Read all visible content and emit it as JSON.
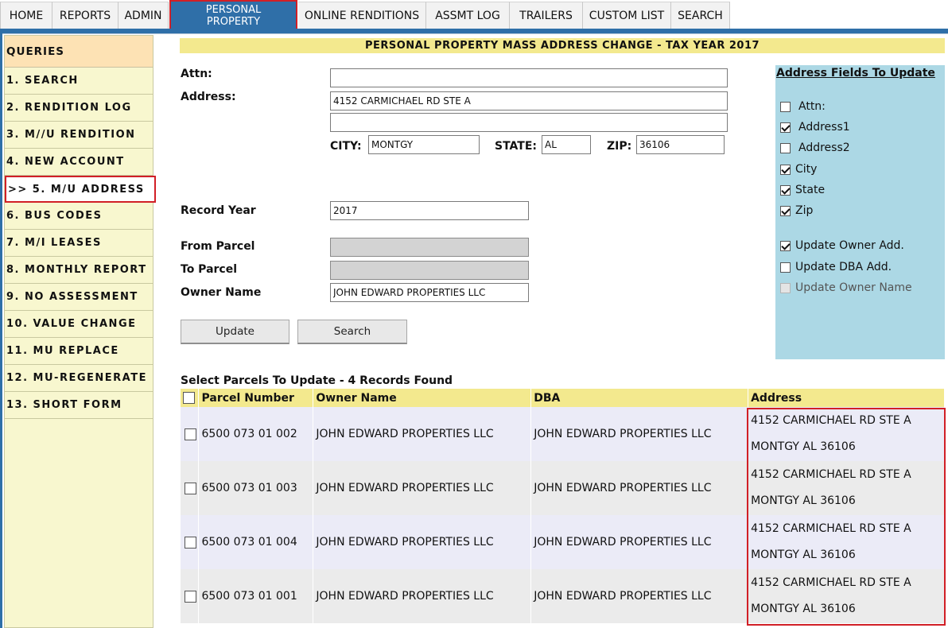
{
  "nav": {
    "tabs": [
      {
        "label": "HOME"
      },
      {
        "label": "REPORTS"
      },
      {
        "label": "ADMIN"
      },
      {
        "label": "PERSONAL PROPERTY",
        "active": true
      },
      {
        "label": "ONLINE RENDITIONS"
      },
      {
        "label": "ASSMT LOG"
      },
      {
        "label": "TRAILERS"
      },
      {
        "label": "CUSTOM LIST"
      },
      {
        "label": "SEARCH"
      }
    ],
    "active_color": "#2f6fa8"
  },
  "sidebar": {
    "header": "QUERIES",
    "items": [
      {
        "label": "1. SEARCH"
      },
      {
        "label": "2. RENDITION LOG"
      },
      {
        "label": "3. M//U RENDITION"
      },
      {
        "label": "4. NEW ACCOUNT"
      },
      {
        "label": ">> 5. M/U ADDRESS",
        "active": true
      },
      {
        "label": "6. BUS CODES"
      },
      {
        "label": "7. M/I LEASES"
      },
      {
        "label": "8. MONTHLY REPORT"
      },
      {
        "label": "9. NO ASSESSMENT"
      },
      {
        "label": "10. VALUE CHANGE"
      },
      {
        "label": "11. MU REPLACE"
      },
      {
        "label": "12. MU-REGENERATE"
      },
      {
        "label": "13. SHORT FORM"
      }
    ]
  },
  "page": {
    "title": "PERSONAL PROPERTY MASS ADDRESS CHANGE - TAX YEAR 2017"
  },
  "form": {
    "attn_label": "Attn:",
    "attn_value": "",
    "address_label": "Address:",
    "address1_value": "4152 CARMICHAEL RD STE A",
    "address2_value": "",
    "city_label": "CITY:",
    "city_value": "MONTGY",
    "state_label": "STATE:",
    "state_value": "AL",
    "zip_label": "ZIP:",
    "zip_value": "36106",
    "record_year_label": "Record Year",
    "record_year_value": "2017",
    "from_parcel_label": "From Parcel",
    "from_parcel_value": "",
    "to_parcel_label": "To Parcel",
    "to_parcel_value": "",
    "owner_name_label": "Owner Name",
    "owner_name_value": "JOHN EDWARD PROPERTIES LLC",
    "update_button": "Update",
    "search_button": "Search"
  },
  "fields_panel": {
    "title": "Address Fields To Update",
    "checkboxes": [
      {
        "label": "Attn:",
        "checked": false
      },
      {
        "label": "Address1",
        "checked": true
      },
      {
        "label": "Address2",
        "checked": false
      },
      {
        "label": "City",
        "checked": true
      },
      {
        "label": "State",
        "checked": true
      },
      {
        "label": "Zip",
        "checked": true
      },
      {
        "label": "Update Owner Add.",
        "checked": true
      },
      {
        "label": "Update DBA Add.",
        "checked": false
      },
      {
        "label": "Update Owner Name",
        "checked": false,
        "disabled": true
      }
    ]
  },
  "results": {
    "title": "Select Parcels To Update -  4 Records Found",
    "columns": [
      "Parcel Number",
      "Owner Name",
      "DBA",
      "Address"
    ],
    "rows": [
      {
        "parcel": "6500 073 01 002",
        "owner": "JOHN EDWARD PROPERTIES LLC",
        "dba": "JOHN EDWARD PROPERTIES LLC",
        "address_line1": "4152 CARMICHAEL RD STE A",
        "address_line2": "MONTGY AL 36106"
      },
      {
        "parcel": "6500 073 01 003",
        "owner": "JOHN EDWARD PROPERTIES LLC",
        "dba": "JOHN EDWARD PROPERTIES LLC",
        "address_line1": "4152 CARMICHAEL RD STE A",
        "address_line2": "MONTGY AL 36106"
      },
      {
        "parcel": "6500 073 01 004",
        "owner": "JOHN EDWARD PROPERTIES LLC",
        "dba": "JOHN EDWARD PROPERTIES LLC",
        "address_line1": "4152 CARMICHAEL RD STE A",
        "address_line2": "MONTGY AL 36106"
      },
      {
        "parcel": "6500 073 01 001",
        "owner": "JOHN EDWARD PROPERTIES LLC",
        "dba": "JOHN EDWARD PROPERTIES LLC",
        "address_line1": "4152 CARMICHAEL RD STE A",
        "address_line2": "MONTGY AL 36106"
      }
    ]
  }
}
